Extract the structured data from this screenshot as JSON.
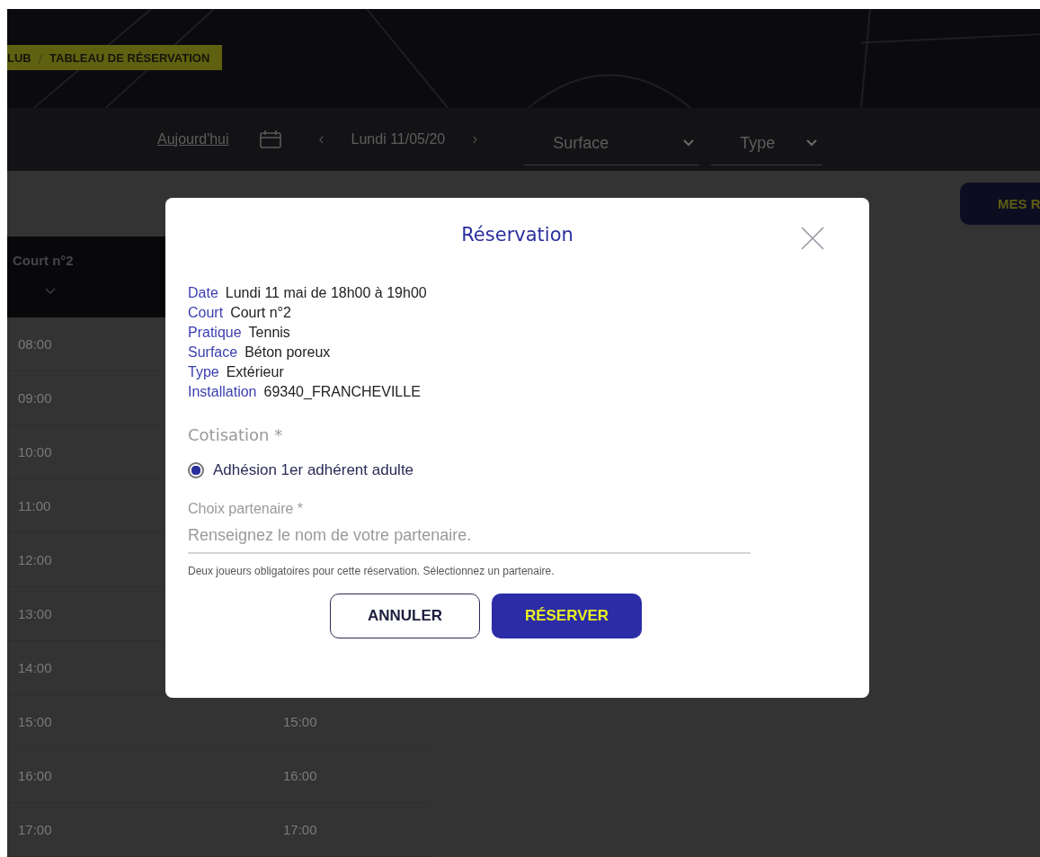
{
  "breadcrumb": [
    {
      "label": "LUB"
    },
    {
      "label": "TABLEAU DE RÉSERVATION"
    }
  ],
  "breadcrumb_separator": "/",
  "toolbar": {
    "today_link": "Aujourd'hui",
    "prev": "‹",
    "date": "Lundi 11/05/20",
    "next": "›",
    "filters": [
      {
        "label": "Surface"
      },
      {
        "label": "Type"
      }
    ]
  },
  "my_bookings_button": "MES R",
  "court_column": {
    "title": "Court n°2"
  },
  "time_columns": [
    [
      "08:00",
      "09:00",
      "10:00",
      "11:00",
      "12:00",
      "13:00",
      "14:00",
      "15:00",
      "16:00",
      "17:00"
    ],
    [
      "15:00",
      "16:00",
      "17:00"
    ]
  ],
  "modal": {
    "title": "Réservation",
    "details": [
      {
        "label": "Date",
        "value": "Lundi 11 mai de 18h00 à 19h00"
      },
      {
        "label": "Court",
        "value": "Court n°2"
      },
      {
        "label": "Pratique",
        "value": "Tennis"
      },
      {
        "label": "Surface",
        "value": "Béton poreux"
      },
      {
        "label": "Type",
        "value": "Extérieur"
      },
      {
        "label": "Installation",
        "value": "69340_FRANCHEVILLE"
      }
    ],
    "cotisation_label": "Cotisation *",
    "cotisation_options": [
      {
        "label": "Adhésion 1er adhérent adulte",
        "selected": true
      }
    ],
    "partner_label": "Choix partenaire *",
    "partner_placeholder": "Renseignez le nom de votre partenaire.",
    "hint": "Deux joueurs obligatoires pour cette réservation. Sélectionnez un partenaire.",
    "buttons": [
      {
        "kind": "secondary",
        "label": "ANNULER"
      },
      {
        "kind": "primary",
        "label": "RÉSERVER"
      }
    ]
  }
}
